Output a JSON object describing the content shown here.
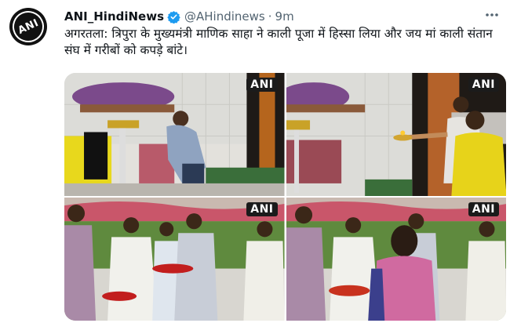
{
  "tweet": {
    "author_name": "ANI_HindiNews",
    "handle": "@AHindinews",
    "separator": "·",
    "time": "9m",
    "text": "अगरतला: त्रिपुरा के मुख्यमंत्री माणिक साहा ने काली पूजा में हिस्सा लिया और जय मां काली संतान संघ में गरीबों को कपड़े बांटे।",
    "avatar_logo": "ANI"
  },
  "icons": {
    "verified": "verified-badge-icon",
    "more": "more-options-icon"
  },
  "colors": {
    "verified": "#1d9bf0",
    "secondary_text": "#536471",
    "primary_text": "#0f1419"
  },
  "media": {
    "watermark": "ANI",
    "photos": [
      {
        "id": "photo-1"
      },
      {
        "id": "photo-2"
      },
      {
        "id": "photo-3"
      },
      {
        "id": "photo-4"
      }
    ]
  }
}
